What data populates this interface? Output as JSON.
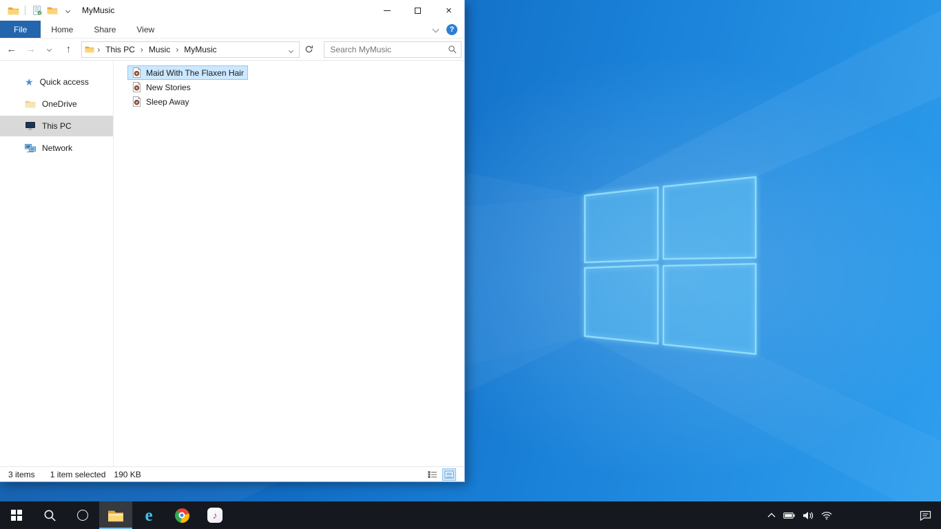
{
  "colors": {
    "accent": "#0078d7",
    "file_tab_blue": "#2466ad",
    "selection_fill": "#cce8ff",
    "selection_border": "#91c9f7",
    "sidebar_selected": "#d9d9d9",
    "taskbar_background": "#15191f",
    "wallpaper_blue": "#1a82d9"
  },
  "window": {
    "title": "MyMusic",
    "ribbon_tabs": [
      {
        "label": "File",
        "active": true
      },
      {
        "label": "Home",
        "active": false
      },
      {
        "label": "Share",
        "active": false
      },
      {
        "label": "View",
        "active": false
      }
    ],
    "address": {
      "segments": [
        "This PC",
        "Music",
        "MyMusic"
      ],
      "separator": "›"
    },
    "search": {
      "placeholder": "Search MyMusic"
    },
    "sidebar": {
      "items": [
        {
          "label": "Quick access",
          "icon": "quick-access-star-icon",
          "selected": false
        },
        {
          "label": "OneDrive",
          "icon": "onedrive-folder-icon",
          "selected": false
        },
        {
          "label": "This PC",
          "icon": "this-pc-monitor-icon",
          "selected": true
        },
        {
          "label": "Network",
          "icon": "network-icon",
          "selected": false
        }
      ]
    },
    "files": {
      "items": [
        {
          "name": "Maid With The Flaxen Hair",
          "icon": "audio-file-icon",
          "selected": true
        },
        {
          "name": "New Stories",
          "icon": "audio-file-icon",
          "selected": false
        },
        {
          "name": "Sleep Away",
          "icon": "audio-file-icon",
          "selected": false
        }
      ]
    },
    "status": {
      "count": "3 items",
      "selection": "1 item selected",
      "size": "190 KB"
    }
  },
  "taskbar": {
    "buttons": [
      {
        "icon": "start-icon"
      },
      {
        "icon": "search-icon"
      },
      {
        "icon": "cortana-icon"
      },
      {
        "icon": "file-explorer-icon",
        "active": true
      },
      {
        "icon": "internet-explorer-icon"
      },
      {
        "icon": "chrome-icon"
      },
      {
        "icon": "itunes-icon"
      }
    ],
    "tray": [
      {
        "icon": "hidden-icons-chevron-icon"
      },
      {
        "icon": "battery-icon"
      },
      {
        "icon": "volume-icon"
      },
      {
        "icon": "wifi-icon"
      }
    ],
    "action_center": {
      "icon": "action-center-icon"
    }
  }
}
